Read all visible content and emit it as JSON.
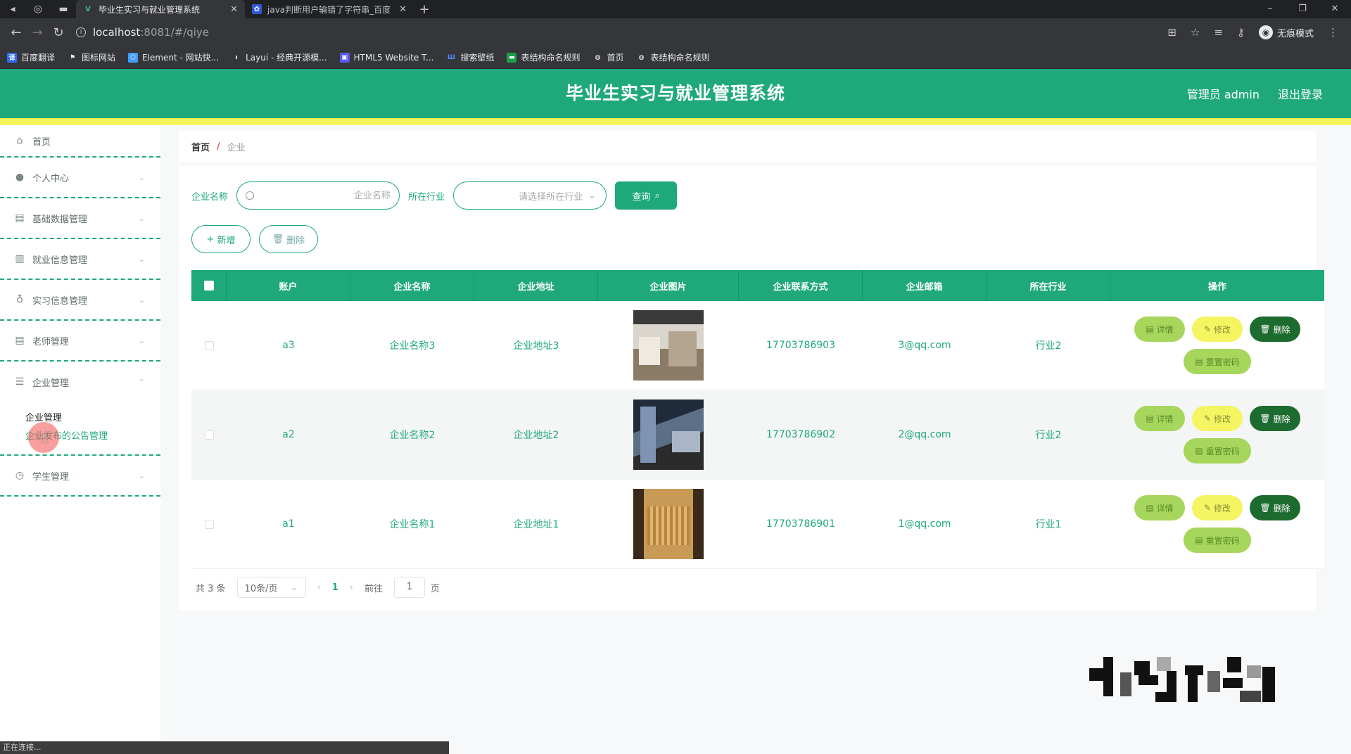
{
  "browser": {
    "tabs": [
      {
        "favicon": "vue-icon",
        "title": "毕业生实习与就业管理系统",
        "active": true
      },
      {
        "favicon": "paw-icon",
        "title": "java判断用户输错了字符串_百度",
        "active": false
      }
    ],
    "url_host": "localhost",
    "url_path": ":8081/#/qiye",
    "profile_label": "无痕模式",
    "bookmarks": [
      "百度翻译",
      "图标网站",
      "Element - 网站快...",
      "Layui - 经典开源模...",
      "HTML5 Website T...",
      "搜索壁纸",
      "表结构命名规则",
      "首页",
      "表结构命名规则"
    ]
  },
  "header": {
    "title": "毕业生实习与就业管理系统",
    "user": "管理员 admin",
    "logout": "退出登录",
    "colors": {
      "primary": "#1fa97a",
      "accent": "#f3f55a"
    }
  },
  "sidebar": {
    "home": "首页",
    "items": [
      {
        "label": "个人中心",
        "icon": "user-icon"
      },
      {
        "label": "基础数据管理",
        "icon": "clipboard-icon"
      },
      {
        "label": "就业信息管理",
        "icon": "bar-chart-icon"
      },
      {
        "label": "实习信息管理",
        "icon": "mic-icon"
      },
      {
        "label": "老师管理",
        "icon": "clipboard-icon"
      },
      {
        "label": "企业管理",
        "icon": "menu-icon",
        "expanded": true
      }
    ],
    "submenu": [
      "企业管理",
      "企业发布的公告管理"
    ],
    "last_item": {
      "label": "学生管理",
      "icon": "clock-icon"
    }
  },
  "breadcrumb": {
    "home": "首页",
    "separator": "/",
    "current": "企业"
  },
  "search": {
    "name_label": "企业名称",
    "name_placeholder": "企业名称",
    "industry_label": "所在行业",
    "industry_placeholder": "请选择所在行业",
    "query_button": "查询"
  },
  "actions": {
    "add": "新增",
    "delete": "删除"
  },
  "table": {
    "headers": [
      "账户",
      "企业名称",
      "企业地址",
      "企业图片",
      "企业联系方式",
      "企业邮箱",
      "所在行业",
      "操作"
    ],
    "rows": [
      {
        "account": "a3",
        "name": "企业名称3",
        "address": "企业地址3",
        "phone": "17703786903",
        "email": "3@qq.com",
        "industry": "行业2"
      },
      {
        "account": "a2",
        "name": "企业名称2",
        "address": "企业地址2",
        "phone": "17703786902",
        "email": "2@qq.com",
        "industry": "行业2"
      },
      {
        "account": "a1",
        "name": "企业名称1",
        "address": "企业地址1",
        "phone": "17703786901",
        "email": "1@qq.com",
        "industry": "行业1"
      }
    ],
    "op_labels": {
      "detail": "详情",
      "edit": "修改",
      "delete": "删除",
      "reset": "重置密码"
    }
  },
  "pager": {
    "total": "共 3 条",
    "page_size": "10条/页",
    "current": "1",
    "goto_prefix": "前往",
    "goto_value": "1",
    "goto_suffix": "页"
  },
  "status_text": "正在连接..."
}
